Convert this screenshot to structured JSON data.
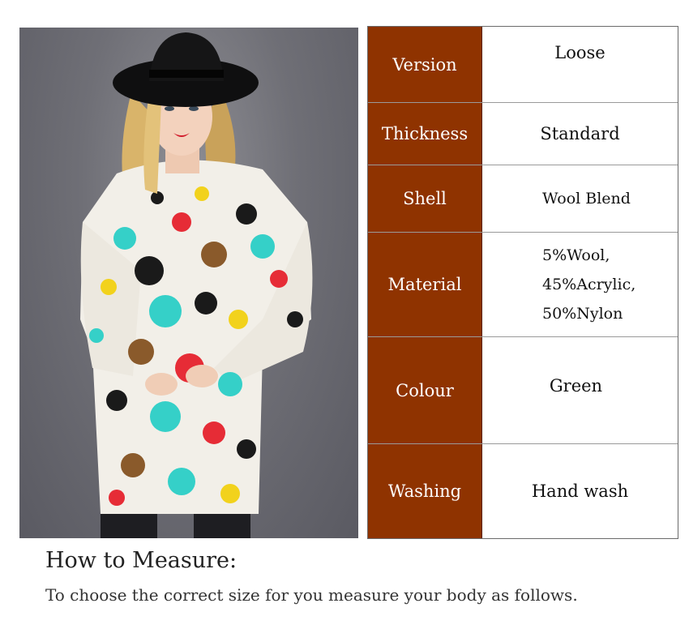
{
  "spec_table": {
    "rows": [
      {
        "label": "Version",
        "value": "Loose"
      },
      {
        "label": "Thickness",
        "value": "Standard"
      },
      {
        "label": "Shell",
        "value": "Wool Blend"
      },
      {
        "label": "Material",
        "value_lines": [
          "5%Wool,",
          "45%Acrylic,",
          "50%Nylon"
        ]
      },
      {
        "label": "Colour",
        "value": "Green"
      },
      {
        "label": "Washing",
        "value": "Hand wash"
      }
    ]
  },
  "measure": {
    "title": "How to Measure:",
    "subtitle": "To choose the correct size for you measure your body as follows."
  },
  "colors": {
    "label_bg": "#8f3300",
    "label_text": "#ffffff",
    "border": "#6b6b6b"
  }
}
